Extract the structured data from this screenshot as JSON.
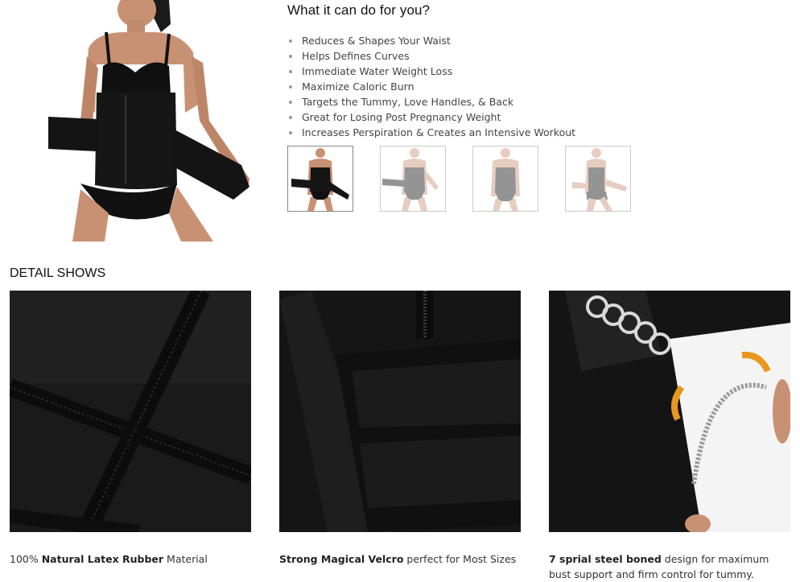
{
  "features": {
    "title": "What it can do for you?",
    "items": [
      "Reduces & Shapes Your Waist",
      "Helps Defines Curves",
      "Immediate Water Weight Loss",
      "Maximize Caloric Burn",
      "Targets the Tummy, Love Handles, & Back",
      "Great for Losing Post Pregnancy Weight",
      "Increases Perspiration & Creates an Intensive Workout"
    ]
  },
  "thumbnails": [
    {
      "name": "thumb-front-belt",
      "selected": true
    },
    {
      "name": "thumb-front-arms-out",
      "selected": false
    },
    {
      "name": "thumb-front-standing",
      "selected": false
    },
    {
      "name": "thumb-side-pose",
      "selected": false
    }
  ],
  "detail": {
    "title": "DETAIL SHOWS",
    "captions": [
      {
        "bold": "",
        "prefix": "100% ",
        "strong": "Natural Latex Rubber",
        "suffix": " Material"
      },
      {
        "prefix": "",
        "strong": "Strong Magical Velcro",
        "suffix": " perfect for Most Sizes"
      },
      {
        "prefix": "",
        "strong": "7 sprial steel boned",
        "suffix": " design for maximum bust support and firm control for tummy."
      }
    ]
  },
  "colors": {
    "fabric": "#151515",
    "skin": "#c99174",
    "accent_arrow": "#e8971f",
    "bullet": "#999999"
  }
}
